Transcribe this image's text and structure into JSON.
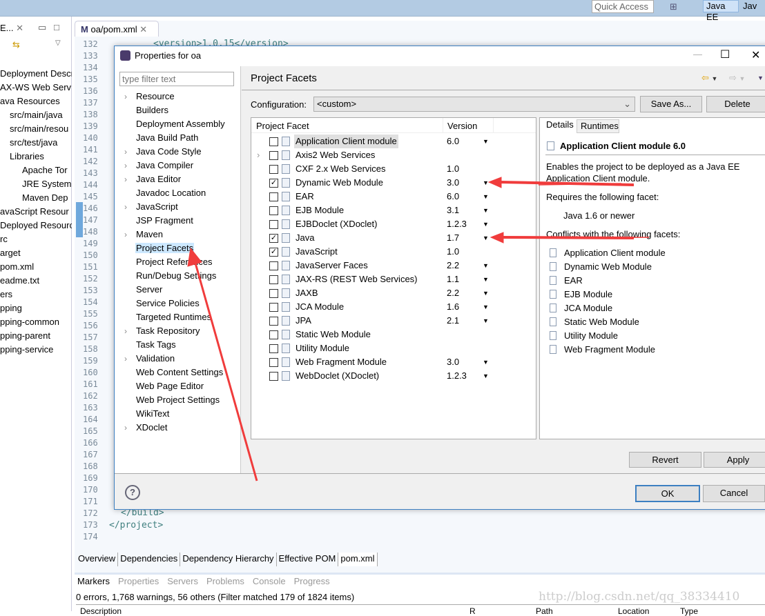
{
  "workbench": {
    "quick_access": "Quick Access",
    "perspective": "Java EE",
    "perspective2": "Jav",
    "explorer_tab": "E...",
    "explorer_items": [
      "Deployment Descr",
      "AX-WS Web Serv",
      "ava Resources",
      "src/main/java",
      "src/main/resou",
      "src/test/java",
      "Libraries",
      "Apache Tor",
      "JRE System",
      "Maven Dep",
      "avaScript Resour",
      "Deployed Resourc",
      "rc",
      "arget",
      "pom.xml",
      "eadme.txt",
      "ers",
      "pping",
      "pping-common",
      "pping-parent",
      "pping-service"
    ],
    "editor_tab": "oa/pom.xml",
    "line_numbers": [
      "132",
      "133",
      "134",
      "135",
      "136",
      "137",
      "138",
      "139",
      "140",
      "141",
      "142",
      "143",
      "144",
      "145",
      "146",
      "147",
      "148",
      "149",
      "150",
      "151",
      "152",
      "153",
      "154",
      "155",
      "156",
      "157",
      "158",
      "159",
      "160",
      "161",
      "162",
      "163",
      "164",
      "165",
      "166",
      "167",
      "168",
      "169",
      "170",
      "171",
      "172",
      "173",
      "174"
    ],
    "code_top": "<version>1.0.15</version>",
    "code_build": "</build>",
    "code_project": "</project>",
    "editor_bottom_tabs": [
      "Overview",
      "Dependencies",
      "Dependency Hierarchy",
      "Effective POM",
      "pom.xml"
    ],
    "view_tabs": [
      "Markers",
      "Properties",
      "Servers",
      "Problems",
      "Console",
      "Progress"
    ],
    "markers_status": "0 errors, 1,768 warnings, 56 others (Filter matched 179 of 1824 items)",
    "markers_columns": [
      "Description",
      "R",
      "Path",
      "Location",
      "Type"
    ],
    "watermark": "http://blog.csdn.net/qq_38334410"
  },
  "dialog": {
    "title": "Properties for oa",
    "filter_placeholder": "type filter text",
    "nav": [
      {
        "label": "Resource",
        "exp": true
      },
      {
        "label": "Builders"
      },
      {
        "label": "Deployment Assembly"
      },
      {
        "label": "Java Build Path"
      },
      {
        "label": "Java Code Style",
        "exp": true
      },
      {
        "label": "Java Compiler",
        "exp": true
      },
      {
        "label": "Java Editor",
        "exp": true
      },
      {
        "label": "Javadoc Location"
      },
      {
        "label": "JavaScript",
        "exp": true
      },
      {
        "label": "JSP Fragment"
      },
      {
        "label": "Maven",
        "exp": true
      },
      {
        "label": "Project Facets",
        "selected": true
      },
      {
        "label": "Project References"
      },
      {
        "label": "Run/Debug Settings"
      },
      {
        "label": "Server"
      },
      {
        "label": "Service Policies"
      },
      {
        "label": "Targeted Runtimes"
      },
      {
        "label": "Task Repository",
        "exp": true
      },
      {
        "label": "Task Tags"
      },
      {
        "label": "Validation",
        "exp": true
      },
      {
        "label": "Web Content Settings"
      },
      {
        "label": "Web Page Editor"
      },
      {
        "label": "Web Project Settings"
      },
      {
        "label": "WikiText"
      },
      {
        "label": "XDoclet",
        "exp": true
      }
    ],
    "page_title": "Project Facets",
    "config_label": "Configuration:",
    "config_value": "<custom>",
    "save_as": "Save As...",
    "delete": "Delete",
    "col_facet": "Project Facet",
    "col_version": "Version",
    "facets": [
      {
        "name": "Application Client module",
        "version": "6.0",
        "dd": true,
        "checked": false,
        "selected": true
      },
      {
        "name": "Axis2 Web Services",
        "version": "",
        "dd": false,
        "checked": false,
        "exp": true
      },
      {
        "name": "CXF 2.x Web Services",
        "version": "1.0",
        "dd": false,
        "checked": false
      },
      {
        "name": "Dynamic Web Module",
        "version": "3.0",
        "dd": true,
        "checked": true
      },
      {
        "name": "EAR",
        "version": "6.0",
        "dd": true,
        "checked": false
      },
      {
        "name": "EJB Module",
        "version": "3.1",
        "dd": true,
        "checked": false
      },
      {
        "name": "EJBDoclet (XDoclet)",
        "version": "1.2.3",
        "dd": true,
        "checked": false
      },
      {
        "name": "Java",
        "version": "1.7",
        "dd": true,
        "checked": true
      },
      {
        "name": "JavaScript",
        "version": "1.0",
        "dd": false,
        "checked": true
      },
      {
        "name": "JavaServer Faces",
        "version": "2.2",
        "dd": true,
        "checked": false
      },
      {
        "name": "JAX-RS (REST Web Services)",
        "version": "1.1",
        "dd": true,
        "checked": false
      },
      {
        "name": "JAXB",
        "version": "2.2",
        "dd": true,
        "checked": false
      },
      {
        "name": "JCA Module",
        "version": "1.6",
        "dd": true,
        "checked": false
      },
      {
        "name": "JPA",
        "version": "2.1",
        "dd": true,
        "checked": false
      },
      {
        "name": "Static Web Module",
        "version": "",
        "dd": false,
        "checked": false
      },
      {
        "name": "Utility Module",
        "version": "",
        "dd": false,
        "checked": false
      },
      {
        "name": "Web Fragment Module",
        "version": "3.0",
        "dd": true,
        "checked": false
      },
      {
        "name": "WebDoclet (XDoclet)",
        "version": "1.2.3",
        "dd": true,
        "checked": false
      }
    ],
    "details_tab": "Details",
    "runtimes_tab": "Runtimes",
    "details": {
      "title": "Application Client module 6.0",
      "desc1": "Enables the project to be deployed as a Java EE",
      "desc2": "Application Client module.",
      "requires_label": "Requires the following facet:",
      "requires": [
        "Java 1.6 or newer"
      ],
      "conflicts_label": "Conflicts with the following facets:",
      "conflicts": [
        "Application Client module",
        "Dynamic Web Module",
        "EAR",
        "EJB Module",
        "JCA Module",
        "Static Web Module",
        "Utility Module",
        "Web Fragment Module"
      ]
    },
    "revert": "Revert",
    "apply": "Apply",
    "ok": "OK",
    "cancel": "Cancel"
  },
  "colors": {
    "annotation": "#f03c3c",
    "selection": "#cce8ff",
    "accent": "#3c7fc1"
  }
}
